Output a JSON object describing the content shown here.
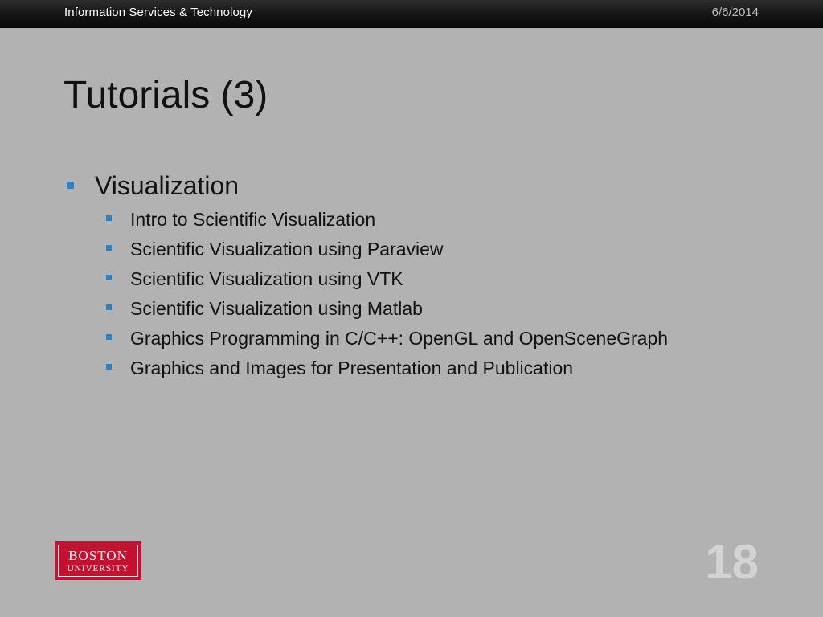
{
  "header": {
    "left": "Information Services & Technology",
    "date": "6/6/2014"
  },
  "slide": {
    "title": "Tutorials (3)",
    "bullet": "Visualization",
    "sub_items": [
      "Intro to Scientific Visualization",
      "Scientific Visualization using Paraview",
      "Scientific Visualization using VTK",
      "Scientific Visualization using Matlab",
      "Graphics Programming in C/C++: OpenGL and OpenSceneGraph",
      "Graphics and Images for Presentation and Publication"
    ]
  },
  "footer": {
    "logo_line1": "BOSTON",
    "logo_line2": "UNIVERSITY",
    "page_number": "18"
  },
  "colors": {
    "background": "#b2b2b2",
    "bullet": "#2a83c6",
    "logo": "#c8102e"
  }
}
